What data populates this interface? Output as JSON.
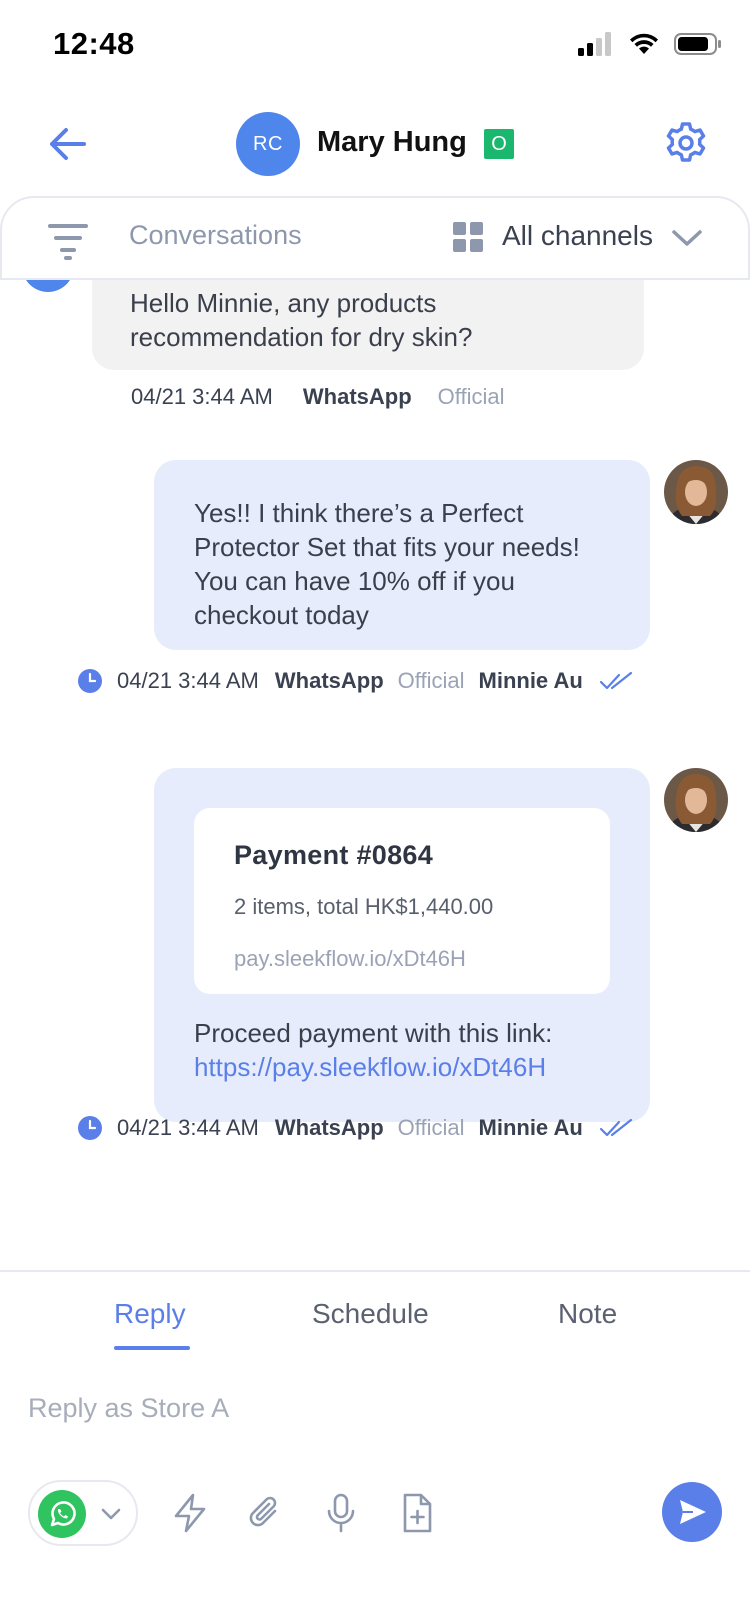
{
  "status_bar": {
    "time": "12:48"
  },
  "header": {
    "avatar_initials": "RC",
    "contact_name": "Mary Hung",
    "status_badge": "O",
    "accent_color": "#5b7fe8"
  },
  "filter_bar": {
    "conversations_label": "Conversations",
    "channels_label": "All channels"
  },
  "messages": [
    {
      "direction": "incoming",
      "text": "Hello Minnie, any products recommendation for dry skin?",
      "time": "04/21 3:44 AM",
      "channel": "WhatsApp",
      "channel_type": "Official"
    },
    {
      "direction": "outgoing",
      "text": "Yes!! I think there’s a Perfect Protector Set that fits your needs! You can have 10% off if you checkout today",
      "time": "04/21 3:44 AM",
      "channel": "WhatsApp",
      "channel_type": "Official",
      "agent": "Minnie Au"
    },
    {
      "direction": "outgoing",
      "payment": {
        "title": "Payment #0864",
        "summary": "2 items, total HK$1,440.00",
        "link": "pay.sleekflow.io/xDt46H"
      },
      "text": "Proceed payment with this link:",
      "url": "https://pay.sleekflow.io/xDt46H",
      "time": "04/21 3:44 AM",
      "channel": "WhatsApp",
      "channel_type": "Official",
      "agent": "Minnie Au"
    }
  ],
  "composer": {
    "tabs": [
      "Reply",
      "Schedule",
      "Note"
    ],
    "active_tab": "Reply",
    "placeholder": "Reply as Store A",
    "tools": [
      "whatsapp-icon",
      "lightning-icon",
      "paperclip-icon",
      "microphone-icon",
      "add-file-icon",
      "send-icon"
    ]
  }
}
